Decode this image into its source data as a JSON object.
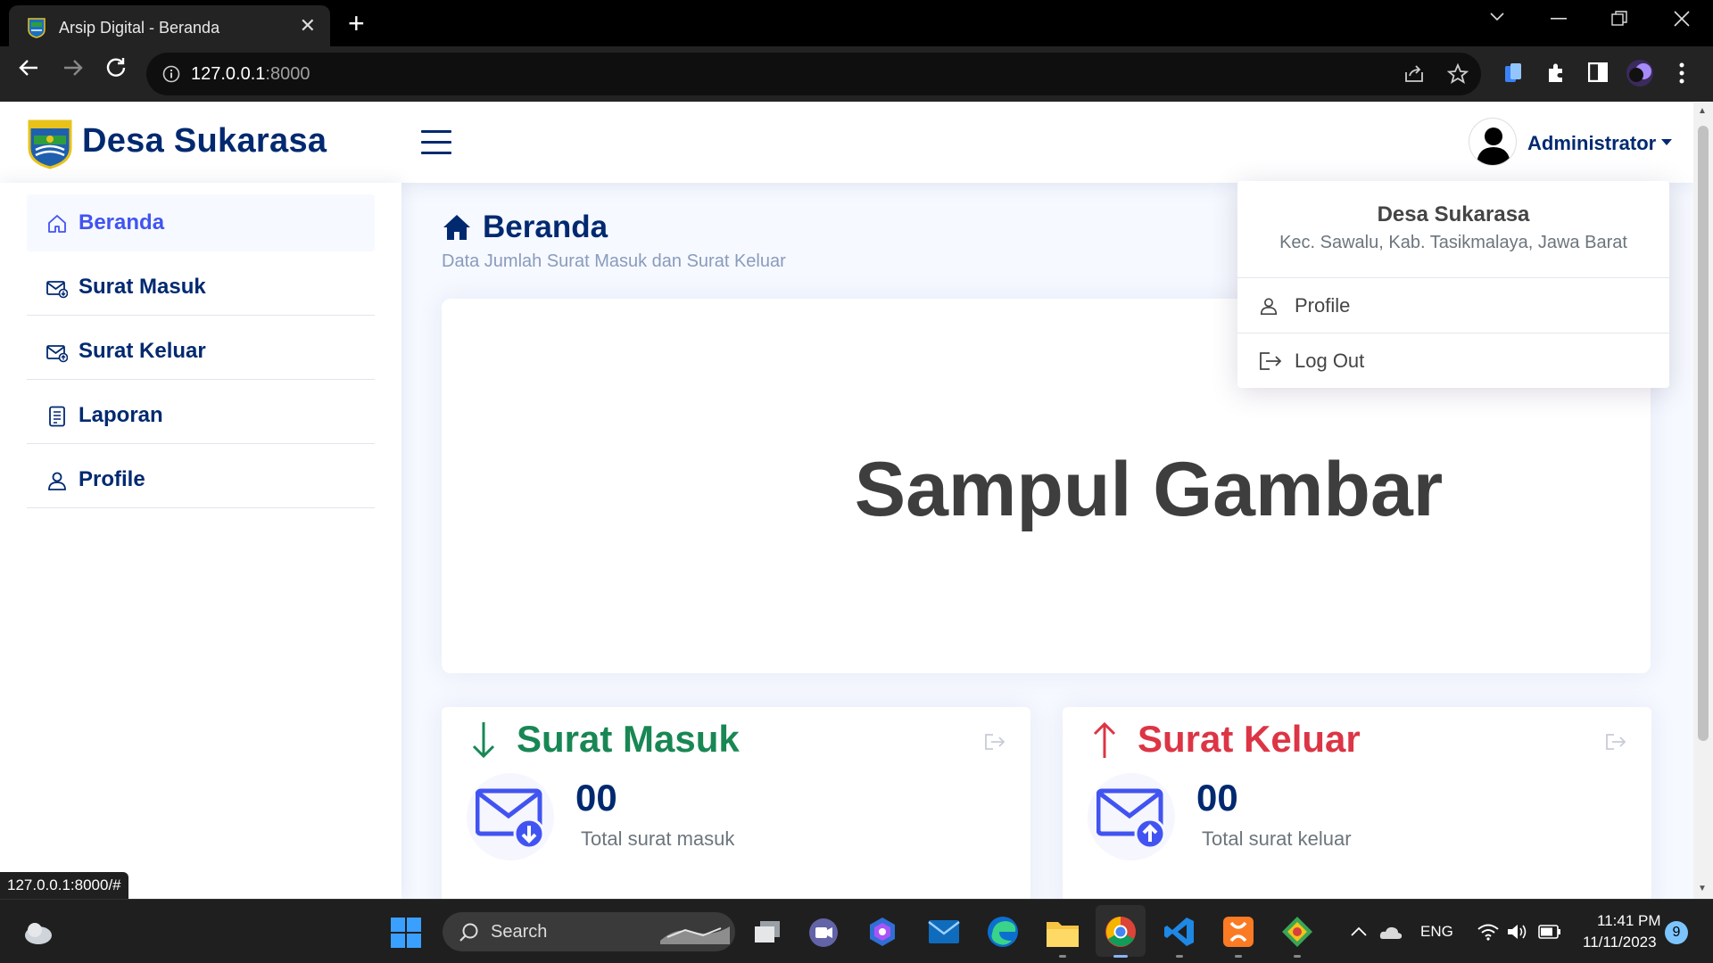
{
  "browser": {
    "tab_title": "Arsip Digital - Beranda",
    "tab_close": "✕",
    "new_tab": "+",
    "url_host": "127.0.0.1",
    "url_port": ":8000"
  },
  "header": {
    "brand": "Desa Sukarasa",
    "user_name": "Administrator"
  },
  "sidebar": {
    "items": [
      {
        "label": "Beranda",
        "icon": "home-icon",
        "active": true
      },
      {
        "label": "Surat Masuk",
        "icon": "mail-in-icon"
      },
      {
        "label": "Surat Keluar",
        "icon": "mail-out-icon"
      },
      {
        "label": "Laporan",
        "icon": "report-icon"
      },
      {
        "label": "Profile",
        "icon": "person-icon"
      }
    ]
  },
  "main": {
    "page_title": "Beranda",
    "subtitle": "Data Jumlah Surat Masuk dan Surat Keluar",
    "cover_text": "Sampul Gambar",
    "cards": [
      {
        "title": "Surat Masuk",
        "count": "00",
        "caption": "Total surat masuk",
        "color": "#198754"
      },
      {
        "title": "Surat Keluar",
        "count": "00",
        "caption": "Total surat keluar",
        "color": "#dc3545"
      }
    ]
  },
  "dropdown": {
    "name": "Desa Sukarasa",
    "address": "Kec. Sawalu, Kab. Tasikmalaya, Jawa Barat",
    "items": [
      {
        "label": "Profile",
        "icon": "person-icon"
      },
      {
        "label": "Log Out",
        "icon": "logout-icon"
      }
    ]
  },
  "status_bar_url": "127.0.0.1:8000/#",
  "taskbar": {
    "search_label": "Search",
    "language": "ENG",
    "time": "11:41 PM",
    "date": "11/11/2023",
    "notification_count": "9"
  },
  "colors": {
    "primary": "#4154f1",
    "navy": "#012970",
    "success": "#198754",
    "danger": "#dc3545"
  }
}
